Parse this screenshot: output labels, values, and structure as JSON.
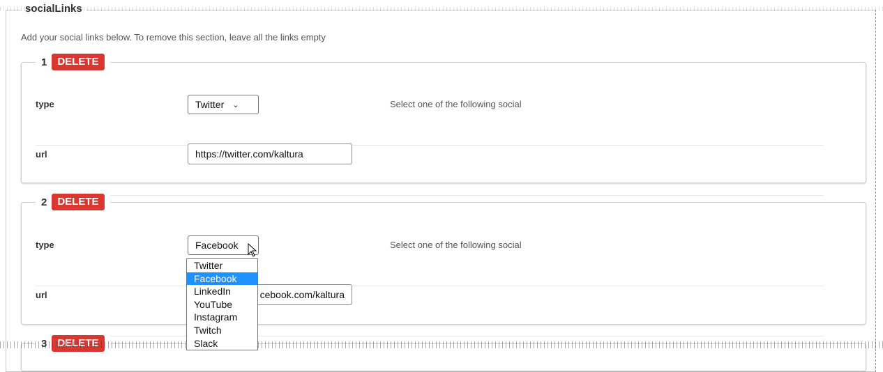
{
  "section": {
    "title": "socialLinks",
    "description": "Add your social links below. To remove this section, leave all the links empty"
  },
  "entries": [
    {
      "number": "1",
      "delete_label": "DELETE",
      "type_label": "type",
      "type_value": "Twitter",
      "type_hint": "Select one of the following social",
      "url_label": "url",
      "url_value": "https://twitter.com/kaltura"
    },
    {
      "number": "2",
      "delete_label": "DELETE",
      "type_label": "type",
      "type_value": "Facebook",
      "type_hint": "Select one of the following social",
      "url_label": "url",
      "url_value": "cebook.com/kaltura"
    },
    {
      "number": "3",
      "delete_label": "DELETE"
    }
  ],
  "dropdown": {
    "options": [
      "Twitter",
      "Facebook",
      "LinkedIn",
      "YouTube",
      "Instagram",
      "Twitch",
      "Slack"
    ],
    "selected": "Facebook"
  },
  "colors": {
    "delete_button": "#d9372f",
    "selected_option": "#1e90ff"
  },
  "icons": {
    "select_arrow": "chevron-down-icon",
    "cursor": "mouse-pointer-icon"
  }
}
